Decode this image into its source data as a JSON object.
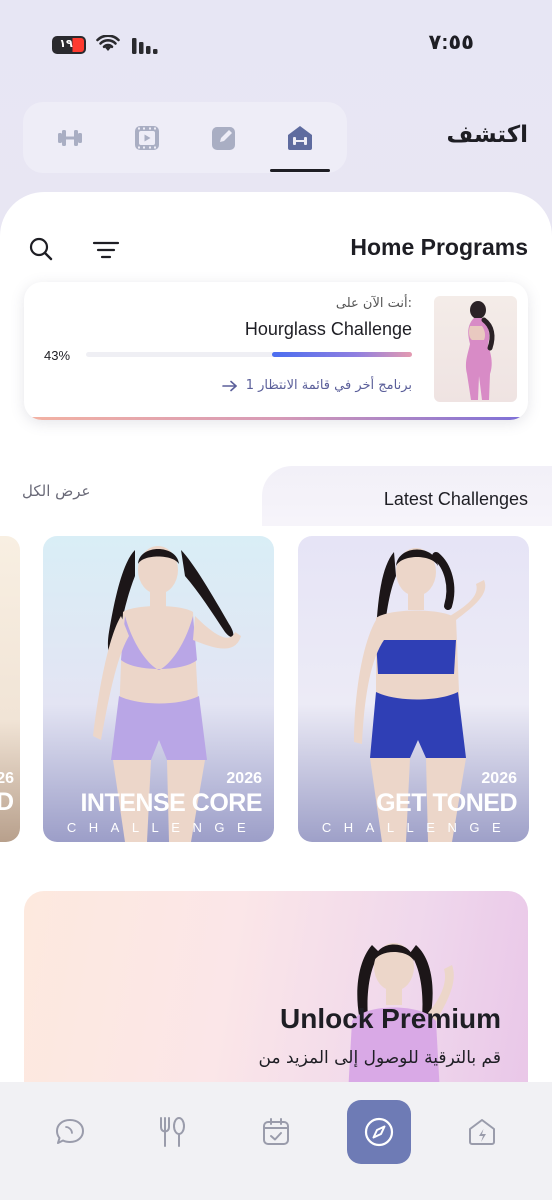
{
  "status_bar": {
    "time": "٧:٥٥",
    "battery": "١٩"
  },
  "header": {
    "title": "اكتشف",
    "tabs": [
      {
        "icon": "dumbbell-icon",
        "active": false
      },
      {
        "icon": "video-icon",
        "active": false
      },
      {
        "icon": "edit-icon",
        "active": false
      },
      {
        "icon": "home-dumbbell-icon",
        "active": true
      }
    ]
  },
  "section": {
    "title": "Home Programs"
  },
  "current_program": {
    "label": "أنت الآن على:",
    "name": "Hourglass Challenge",
    "progress_text": "43%",
    "progress": 0.43,
    "waitlist": "1 برنامج أخر في قائمة الانتظار"
  },
  "latest": {
    "title": "Latest Challenges",
    "view_all": "عرض الكل",
    "partial_card": {
      "year": "26",
      "letter": "D"
    },
    "cards": [
      {
        "year": "2026",
        "name": "INTENSE CORE",
        "subtitle": "CHALLENGE",
        "outfit": "#b9a6e6"
      },
      {
        "year": "2026",
        "name": "GET TONED",
        "subtitle": "CHALLENGE",
        "outfit": "#2f3fb5"
      }
    ]
  },
  "premium": {
    "title": "Unlock Premium",
    "subtitle": "قم بالترقية للوصول إلى المزيد من"
  },
  "bottom_nav": {
    "items": [
      "chat-icon",
      "nutrition-icon",
      "calendar-icon",
      "explore-icon",
      "home-icon"
    ],
    "active": "explore-icon"
  }
}
